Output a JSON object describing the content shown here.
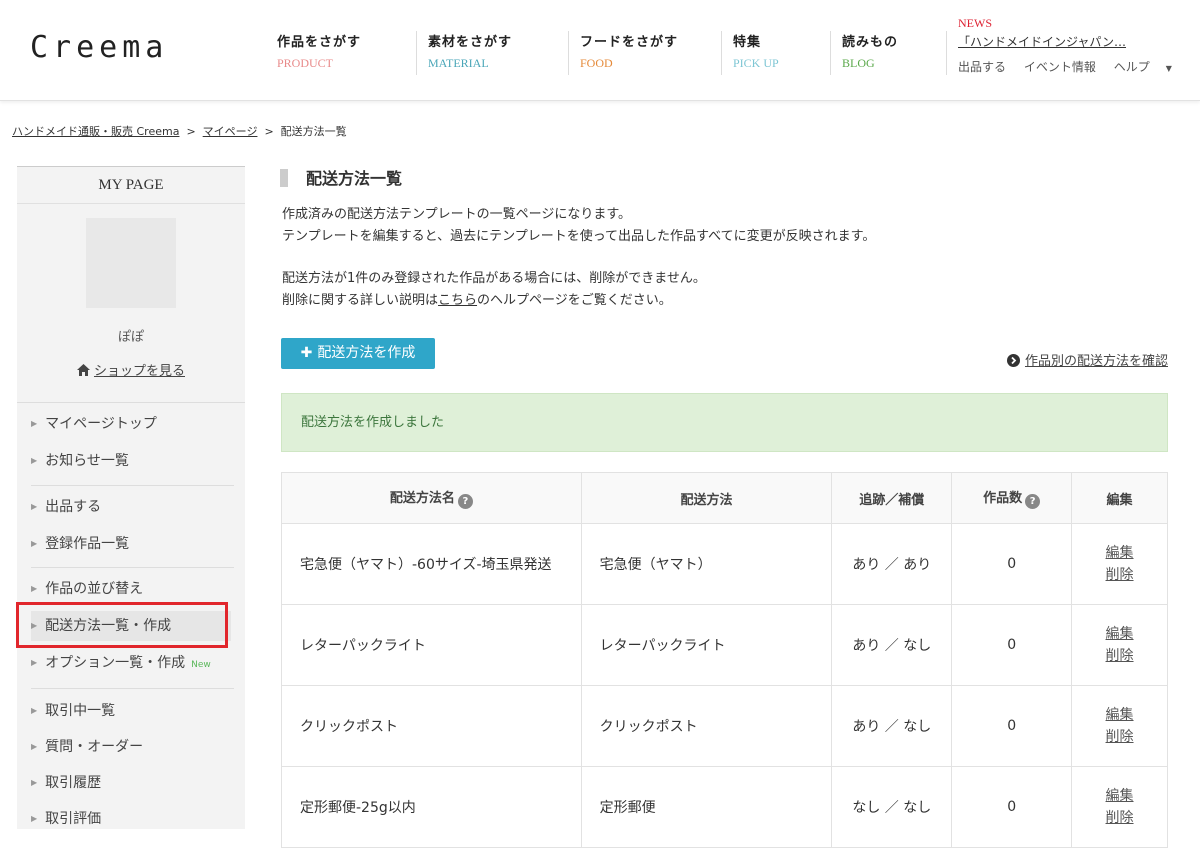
{
  "header": {
    "logo": "Creema",
    "nav": [
      {
        "jp": "作品をさがす",
        "en": "PRODUCT",
        "color": "#e88a8a"
      },
      {
        "jp": "素材をさがす",
        "en": "MATERIAL",
        "color": "#4aa6b8"
      },
      {
        "jp": "フードをさがす",
        "en": "FOOD",
        "color": "#e58a3a"
      },
      {
        "jp": "特集",
        "en": "PICK UP",
        "color": "#7ec6d4"
      },
      {
        "jp": "読みもの",
        "en": "BLOG",
        "color": "#5aa84a"
      }
    ],
    "news_label": "NEWS",
    "news_text": "「ハンドメイドインジャパン…",
    "links": [
      "出品する",
      "イベント情報",
      "ヘルプ"
    ]
  },
  "breadcrumb": [
    "ハンドメイド通販・販売 Creema",
    "マイページ",
    "配送方法一覧"
  ],
  "sidebar": {
    "title": "MY PAGE",
    "username": "ぽぽ",
    "shop_link": "ショップを見る",
    "items": [
      {
        "label": "マイページトップ"
      },
      {
        "label": "お知らせ一覧"
      },
      {
        "label": "出品する"
      },
      {
        "label": "登録作品一覧"
      },
      {
        "label": "作品の並び替え"
      },
      {
        "label": "配送方法一覧・作成"
      },
      {
        "label": "オプション一覧・作成",
        "badge": "New"
      },
      {
        "label": "取引中一覧"
      },
      {
        "label": "質問・オーダー"
      },
      {
        "label": "取引履歴"
      },
      {
        "label": "取引評価"
      }
    ]
  },
  "main": {
    "title": "配送方法一覧",
    "desc1": "作成済みの配送方法テンプレートの一覧ページになります。",
    "desc2": "テンプレートを編集すると、過去にテンプレートを使って出品した作品すべてに変更が反映されます。",
    "desc3": "配送方法が1件のみ登録された作品がある場合には、削除ができません。",
    "desc4_pre": "削除に関する詳しい説明は",
    "desc4_link": "こちら",
    "desc4_post": "のヘルプページをご覧ください。",
    "create_button": "配送方法を作成",
    "check_link": "作品別の配送方法を確認",
    "alert": "配送方法を作成しました",
    "table": {
      "headers": [
        "配送方法名",
        "配送方法",
        "追跡／補償",
        "作品数",
        "編集"
      ],
      "rows": [
        {
          "name": "宅急便（ヤマト）-60サイズ-埼玉県発送",
          "method": "宅急便（ヤマト）",
          "tracking": "あり ／ あり",
          "count": "0",
          "edit": "編集",
          "delete": "削除"
        },
        {
          "name": "レターパックライト",
          "method": "レターパックライト",
          "tracking": "あり ／ なし",
          "count": "0",
          "edit": "編集",
          "delete": "削除"
        },
        {
          "name": "クリックポスト",
          "method": "クリックポスト",
          "tracking": "あり ／ なし",
          "count": "0",
          "edit": "編集",
          "delete": "削除"
        },
        {
          "name": "定形郵便-25g以内",
          "method": "定形郵便",
          "tracking": "なし ／ なし",
          "count": "0",
          "edit": "編集",
          "delete": "削除"
        }
      ]
    }
  }
}
